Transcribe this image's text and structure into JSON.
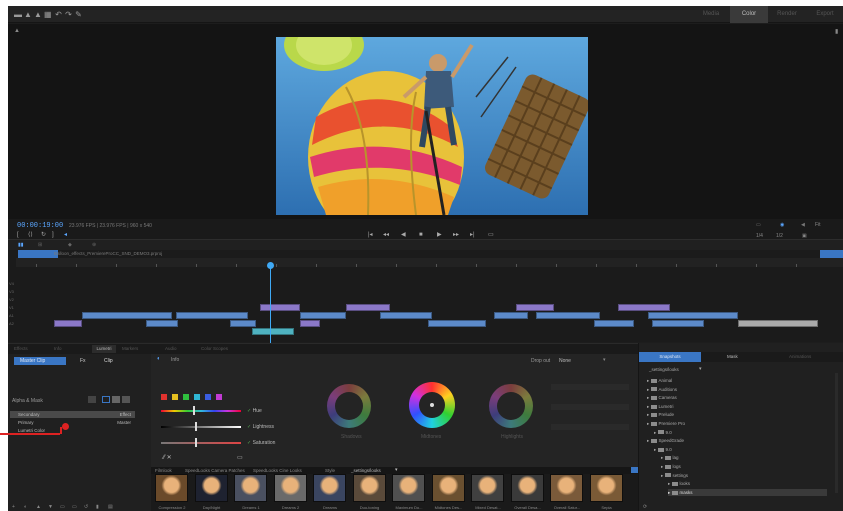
{
  "toolbar": {
    "icons": [
      "folder-icon",
      "export-icon",
      "share-icon",
      "grid-icon",
      "undo-icon",
      "redo-icon",
      "wrench-icon"
    ],
    "workspaces": [
      {
        "label": "Media",
        "active": false
      },
      {
        "label": "Color",
        "active": true
      },
      {
        "label": "Render",
        "active": false
      },
      {
        "label": "Export",
        "active": false
      }
    ]
  },
  "monitor": {
    "timecode": "00:00:19:00",
    "info": "23.976 FPS | 23.976 FPS  |  960 x 540",
    "zoom_options": [
      "Fit"
    ],
    "res_options": [
      "1/4",
      "1/2"
    ]
  },
  "timeline": {
    "timecode": "00:00:19:00",
    "sequence_name": "Balloon_effects_PremiereProCC_SND_DEMO3.prproj",
    "tracks": [
      "V4",
      "V3",
      "V2",
      "V1",
      "A1",
      "A2"
    ]
  },
  "lumetri": {
    "tabs": [
      "Effects",
      "Info",
      "Lumetri",
      "Markers",
      "Audio",
      "Color Scopes"
    ],
    "active_tab": "Lumetri",
    "master_button": "Master Clip",
    "fx_label": "Fx",
    "clip_label": "Clip",
    "info_tab": "Info",
    "alpha_mask_label": "Alpha & Mask",
    "layers": [
      {
        "name": "Secondary",
        "selected": true,
        "right": "Effect"
      },
      {
        "name": "Primary",
        "selected": false,
        "right": "Master"
      },
      {
        "name": "Lumetri Color",
        "selected": false,
        "right": ""
      }
    ],
    "dropdown_label": "Drop out",
    "dropdown_value": "None",
    "sliders": [
      {
        "name": "Hue",
        "value": 0.4
      },
      {
        "name": "Lightness",
        "value": 0.42
      },
      {
        "name": "Saturation",
        "value": 0.42
      }
    ],
    "wheels": [
      "Shadows",
      "Midtones",
      "Highlights"
    ],
    "swatch_colors": [
      "#e0322e",
      "#e6c020",
      "#2fbf3e",
      "#2fb6d4",
      "#3a5de0",
      "#c23bd4"
    ],
    "look_tabs": [
      "Filmlook",
      "SpeedLooks Camera Patches",
      "SpeedLooks Cine Looks",
      "Style",
      "_settings/looks"
    ],
    "looks": [
      "Compression 2",
      "Day/Night",
      "Dreams 1",
      "Dreams 2",
      "Dreams",
      "Duo-toning",
      "Maximum Do...",
      "Midtones Des...",
      "Mixed Desat...",
      "Overall Desa...",
      "Overall Satur...",
      "Sepia"
    ]
  },
  "browser": {
    "tabs": [
      "Snapshots",
      "Mask",
      "Animations"
    ],
    "active_tab": "Snapshots",
    "path": "_settings/looks",
    "tree": [
      {
        "label": "Animal",
        "depth": 0,
        "selected": false
      },
      {
        "label": "Auditions",
        "depth": 0,
        "selected": false
      },
      {
        "label": "Cameras",
        "depth": 0,
        "selected": false
      },
      {
        "label": "Lumetri",
        "depth": 0,
        "selected": false
      },
      {
        "label": "Prelude",
        "depth": 0,
        "selected": false
      },
      {
        "label": "Premiere Pro",
        "depth": 0,
        "selected": false
      },
      {
        "label": "9.0",
        "depth": 1,
        "selected": false
      },
      {
        "label": "SpeedGrade",
        "depth": 0,
        "selected": false
      },
      {
        "label": "9.0",
        "depth": 1,
        "selected": false
      },
      {
        "label": "lag",
        "depth": 2,
        "selected": false
      },
      {
        "label": "logs",
        "depth": 2,
        "selected": false
      },
      {
        "label": "settings",
        "depth": 2,
        "selected": false
      },
      {
        "label": "looks",
        "depth": 3,
        "selected": false
      },
      {
        "label": "masks",
        "depth": 3,
        "selected": true
      }
    ]
  },
  "colors": {
    "accent": "#3a76c4",
    "playhead": "#3fa9f5",
    "timecode": "#5aa6ff",
    "callout": "#dd2222"
  }
}
